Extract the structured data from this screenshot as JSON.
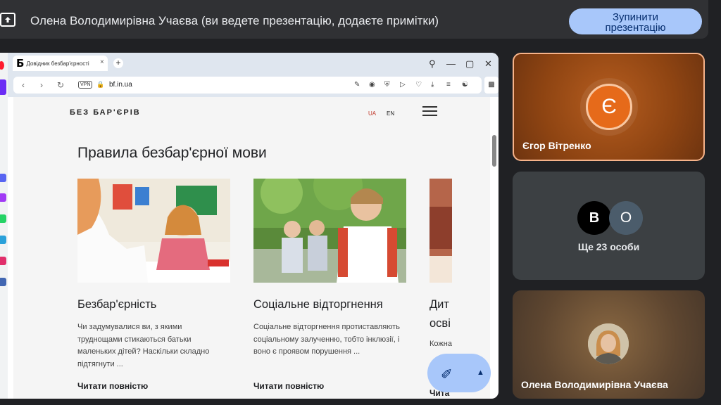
{
  "presenting_bar": {
    "status_text": "Олена Володимирівна Учаєва (ви ведете презентацію, додаєте примітки)",
    "stop_button_line1": "Зупинити",
    "stop_button_line2": "презентацію"
  },
  "browser": {
    "tab_favicon": "Б",
    "tab_title": "Довідник безбар'єрності",
    "tab_close": "×",
    "new_tab": "+",
    "vpn_label": "VPN",
    "url": "bf.in.ua"
  },
  "page": {
    "logo": "БЕЗ БАР'ЄРІВ",
    "lang_ua": "UA",
    "lang_en": "EN",
    "title": "Правила безбар'єрної мови",
    "cards": [
      {
        "title": "Безбар'єрність",
        "text": "Чи задумувалися ви, з якими труднощами стикаються батьки маленьких дітей? Наскільки складно підтягнути ...",
        "link": "Читати повністю"
      },
      {
        "title": "Соціальне відторгнення",
        "text": "Соціальне відторгнення протиставляють соціальному залученню, тобто інклюзії, і воно є проявом порушення ...",
        "link": "Читати повністю"
      },
      {
        "title_line1": "Дит",
        "title_line2": "осві",
        "text": "Кожна",
        "link": "Чита"
      }
    ]
  },
  "participants": {
    "tile1": {
      "initial": "Є",
      "name": "Єгор Вітренко"
    },
    "tile2": {
      "initial_b": "В",
      "initial_o": "О",
      "more": "Ще 23 особи"
    },
    "tile3": {
      "name": "Олена Володимирівна Учаєва"
    }
  },
  "colors": {
    "accent": "#a8c7fa",
    "background": "#202124",
    "tile_active_border": "#f6b38a",
    "avatar_orange": "#e66a1a"
  }
}
